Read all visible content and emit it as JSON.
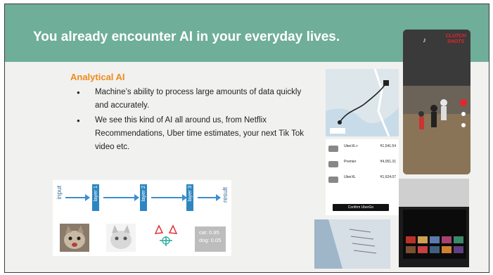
{
  "slide": {
    "title": "You already encounter AI in your everyday lives.",
    "heading": "Analytical AI",
    "bullets": [
      "Machine’s ability to process large amounts of data quickly and accurately.",
      "We see this kind of AI all around us, from Netflix Recommendations, Uber time estimates, your next Tik Tok video etc."
    ]
  },
  "diagram": {
    "input_label": "input",
    "layers": [
      "layer 1",
      "layer 2",
      "layer 3"
    ],
    "result_label": "result",
    "output_cat": "cat: 0.95",
    "output_dog": "dog: 0.05"
  },
  "uber": {
    "rows": [
      {
        "name": "UberXL+",
        "price": "₹1,541.54"
      },
      {
        "name": "Premier",
        "price": "₹4,051.31"
      },
      {
        "name": "UberXL",
        "price": "₹1,624.07"
      }
    ],
    "confirm": "Confirm UberGo"
  },
  "tiktok": {
    "brand": "CLUTCH SHOTS"
  },
  "colors": {
    "title_bar": "#6fae98",
    "heading": "#f08a1a",
    "diagram_blue": "#2e86c1"
  }
}
